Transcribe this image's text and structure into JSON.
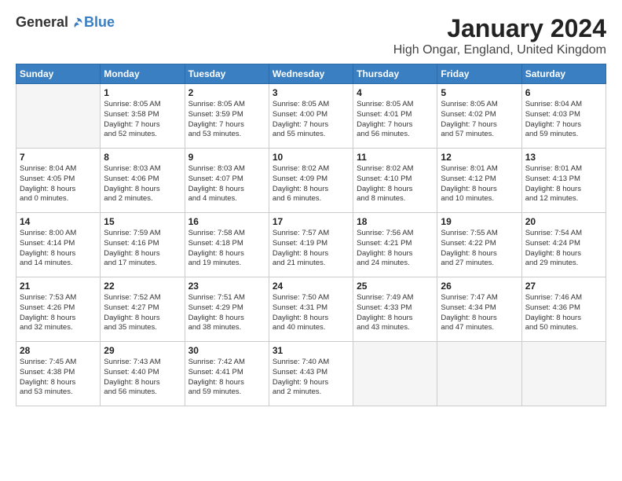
{
  "header": {
    "logo_general": "General",
    "logo_blue": "Blue",
    "month": "January 2024",
    "location": "High Ongar, England, United Kingdom"
  },
  "weekdays": [
    "Sunday",
    "Monday",
    "Tuesday",
    "Wednesday",
    "Thursday",
    "Friday",
    "Saturday"
  ],
  "weeks": [
    [
      {
        "day": "",
        "info": ""
      },
      {
        "day": "1",
        "info": "Sunrise: 8:05 AM\nSunset: 3:58 PM\nDaylight: 7 hours\nand 52 minutes."
      },
      {
        "day": "2",
        "info": "Sunrise: 8:05 AM\nSunset: 3:59 PM\nDaylight: 7 hours\nand 53 minutes."
      },
      {
        "day": "3",
        "info": "Sunrise: 8:05 AM\nSunset: 4:00 PM\nDaylight: 7 hours\nand 55 minutes."
      },
      {
        "day": "4",
        "info": "Sunrise: 8:05 AM\nSunset: 4:01 PM\nDaylight: 7 hours\nand 56 minutes."
      },
      {
        "day": "5",
        "info": "Sunrise: 8:05 AM\nSunset: 4:02 PM\nDaylight: 7 hours\nand 57 minutes."
      },
      {
        "day": "6",
        "info": "Sunrise: 8:04 AM\nSunset: 4:03 PM\nDaylight: 7 hours\nand 59 minutes."
      }
    ],
    [
      {
        "day": "7",
        "info": "Sunrise: 8:04 AM\nSunset: 4:05 PM\nDaylight: 8 hours\nand 0 minutes."
      },
      {
        "day": "8",
        "info": "Sunrise: 8:03 AM\nSunset: 4:06 PM\nDaylight: 8 hours\nand 2 minutes."
      },
      {
        "day": "9",
        "info": "Sunrise: 8:03 AM\nSunset: 4:07 PM\nDaylight: 8 hours\nand 4 minutes."
      },
      {
        "day": "10",
        "info": "Sunrise: 8:02 AM\nSunset: 4:09 PM\nDaylight: 8 hours\nand 6 minutes."
      },
      {
        "day": "11",
        "info": "Sunrise: 8:02 AM\nSunset: 4:10 PM\nDaylight: 8 hours\nand 8 minutes."
      },
      {
        "day": "12",
        "info": "Sunrise: 8:01 AM\nSunset: 4:12 PM\nDaylight: 8 hours\nand 10 minutes."
      },
      {
        "day": "13",
        "info": "Sunrise: 8:01 AM\nSunset: 4:13 PM\nDaylight: 8 hours\nand 12 minutes."
      }
    ],
    [
      {
        "day": "14",
        "info": "Sunrise: 8:00 AM\nSunset: 4:14 PM\nDaylight: 8 hours\nand 14 minutes."
      },
      {
        "day": "15",
        "info": "Sunrise: 7:59 AM\nSunset: 4:16 PM\nDaylight: 8 hours\nand 17 minutes."
      },
      {
        "day": "16",
        "info": "Sunrise: 7:58 AM\nSunset: 4:18 PM\nDaylight: 8 hours\nand 19 minutes."
      },
      {
        "day": "17",
        "info": "Sunrise: 7:57 AM\nSunset: 4:19 PM\nDaylight: 8 hours\nand 21 minutes."
      },
      {
        "day": "18",
        "info": "Sunrise: 7:56 AM\nSunset: 4:21 PM\nDaylight: 8 hours\nand 24 minutes."
      },
      {
        "day": "19",
        "info": "Sunrise: 7:55 AM\nSunset: 4:22 PM\nDaylight: 8 hours\nand 27 minutes."
      },
      {
        "day": "20",
        "info": "Sunrise: 7:54 AM\nSunset: 4:24 PM\nDaylight: 8 hours\nand 29 minutes."
      }
    ],
    [
      {
        "day": "21",
        "info": "Sunrise: 7:53 AM\nSunset: 4:26 PM\nDaylight: 8 hours\nand 32 minutes."
      },
      {
        "day": "22",
        "info": "Sunrise: 7:52 AM\nSunset: 4:27 PM\nDaylight: 8 hours\nand 35 minutes."
      },
      {
        "day": "23",
        "info": "Sunrise: 7:51 AM\nSunset: 4:29 PM\nDaylight: 8 hours\nand 38 minutes."
      },
      {
        "day": "24",
        "info": "Sunrise: 7:50 AM\nSunset: 4:31 PM\nDaylight: 8 hours\nand 40 minutes."
      },
      {
        "day": "25",
        "info": "Sunrise: 7:49 AM\nSunset: 4:33 PM\nDaylight: 8 hours\nand 43 minutes."
      },
      {
        "day": "26",
        "info": "Sunrise: 7:47 AM\nSunset: 4:34 PM\nDaylight: 8 hours\nand 47 minutes."
      },
      {
        "day": "27",
        "info": "Sunrise: 7:46 AM\nSunset: 4:36 PM\nDaylight: 8 hours\nand 50 minutes."
      }
    ],
    [
      {
        "day": "28",
        "info": "Sunrise: 7:45 AM\nSunset: 4:38 PM\nDaylight: 8 hours\nand 53 minutes."
      },
      {
        "day": "29",
        "info": "Sunrise: 7:43 AM\nSunset: 4:40 PM\nDaylight: 8 hours\nand 56 minutes."
      },
      {
        "day": "30",
        "info": "Sunrise: 7:42 AM\nSunset: 4:41 PM\nDaylight: 8 hours\nand 59 minutes."
      },
      {
        "day": "31",
        "info": "Sunrise: 7:40 AM\nSunset: 4:43 PM\nDaylight: 9 hours\nand 2 minutes."
      },
      {
        "day": "",
        "info": ""
      },
      {
        "day": "",
        "info": ""
      },
      {
        "day": "",
        "info": ""
      }
    ]
  ]
}
